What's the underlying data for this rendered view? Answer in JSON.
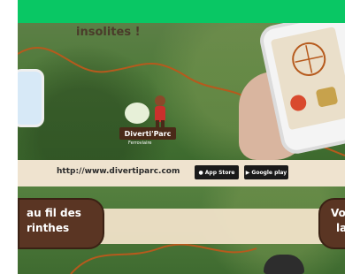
{
  "banner": {
    "heading": "insolites !",
    "logo_name": "Diverti'Parc",
    "logo_sub": "Ferroviaire"
  },
  "url_band": {
    "url": "http://www.divertiparc.com",
    "appstore_label": "App Store",
    "googleplay_label": "Google play"
  },
  "signs": {
    "left_line1": "au fil des",
    "left_line2": "rinthes",
    "right_line1": "Voya",
    "right_line2": "la"
  },
  "colors": {
    "top_bar": "#09c764",
    "sign_brown": "#5a3523",
    "band_beige": "#efe3cf"
  }
}
